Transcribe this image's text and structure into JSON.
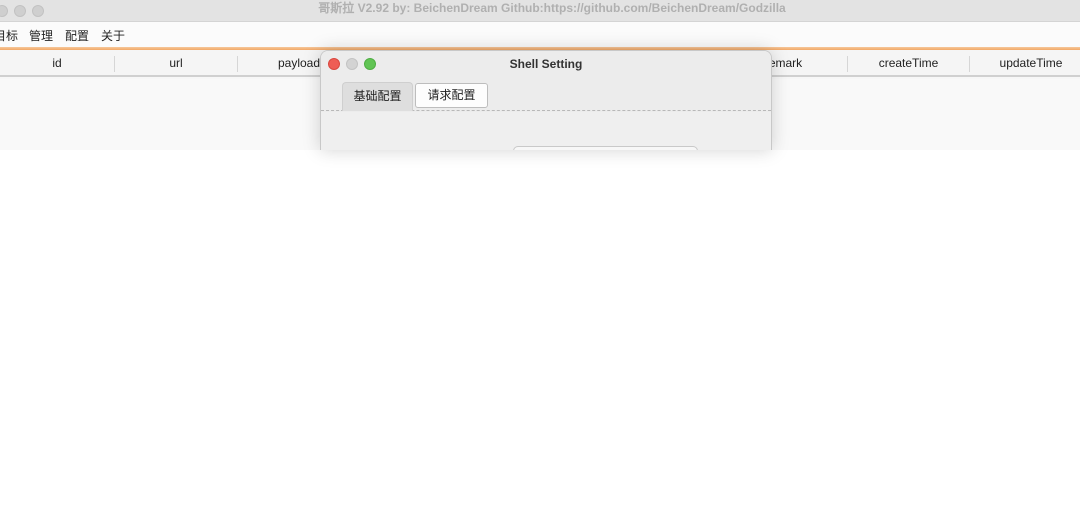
{
  "window": {
    "title": "哥斯拉     V2.92 by: BeichenDream Github:https://github.com/BeichenDream/Godzilla"
  },
  "menu": [
    "目标",
    "管理",
    "配置",
    "关于"
  ],
  "table": {
    "columns": [
      "id",
      "url",
      "payload",
      "remark",
      "createTime",
      "updateTime"
    ],
    "visible_column_text": [
      "id",
      "url",
      "payload",
      "emark",
      "createTime",
      "updateTime"
    ]
  },
  "dialog": {
    "title": "Shell Setting",
    "tabs": [
      {
        "label": "基础配置",
        "active": true
      },
      {
        "label": "请求配置",
        "active": false
      }
    ]
  },
  "colors": {
    "accent_line": "#f3a866",
    "close": "#ee5d55",
    "zoom": "#61c454"
  }
}
